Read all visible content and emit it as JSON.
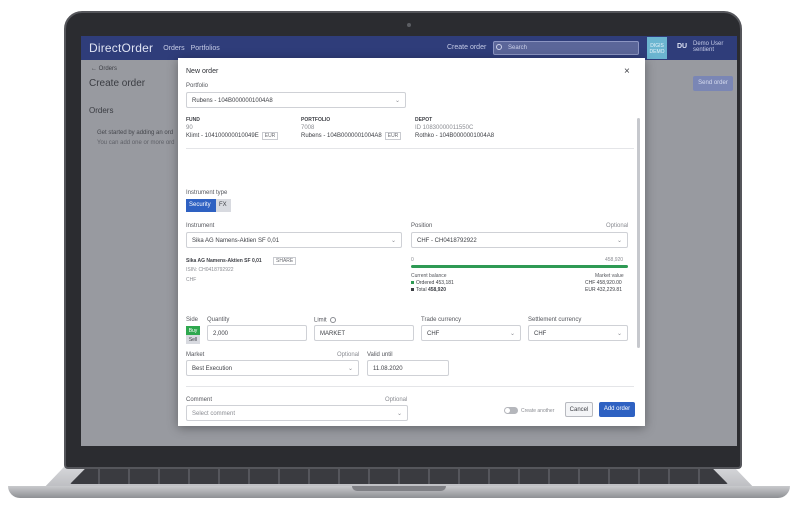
{
  "app": {
    "brand": "DirectOrder",
    "nav": [
      "Orders",
      "Portfolios"
    ],
    "create_order_link": "Create order",
    "search_placeholder": "Search",
    "tile_label": "DIGIS\nDEMO",
    "avatar_initials": "DU",
    "user_name": "Demo User",
    "user_sub": "sentient"
  },
  "page": {
    "back": "← Orders",
    "title": "Create order",
    "orders_heading": "Orders",
    "get_started": "Get started by adding an ord",
    "can_add": "You can add one or more ord",
    "send_button": "Send order"
  },
  "modal": {
    "title": "New order",
    "portfolio_label": "Portfolio",
    "portfolio_value": "Rubens - 104B0000001004A8",
    "fund": {
      "label": "FUND",
      "id": "90",
      "name": "Klimt - 104100000010049E",
      "currency": "EUR"
    },
    "portfolio": {
      "label": "PORTFOLIO",
      "id": "7008",
      "name": "Rubens - 104B0000001004A8",
      "currency": "EUR"
    },
    "depot": {
      "label": "DEPOT",
      "id": "ID 10830000011550C",
      "name": "Rothko - 104B0000001004A8"
    },
    "instrument_type_label": "Instrument type",
    "instrument_type_options": [
      "Security",
      "FX"
    ],
    "instrument_label": "Instrument",
    "instrument_value": "Sika AG Namens-Aktien SF 0,01",
    "position_label": "Position",
    "position_optional": "Optional",
    "position_value": "CHF - CH0418792922",
    "instr_name": "Sika AG Namens-Aktien SF 0,01",
    "instr_tag": "SHARE",
    "instr_isin": "ISIN: CH0418792922",
    "instr_ccy": "CHF",
    "bar_left": "0",
    "bar_right": "458,920",
    "current_balance_label": "Current balance",
    "ordered_label": "Ordered",
    "ordered_value": "453,181",
    "total_label": "Total",
    "total_value": "458,920",
    "market_value_label": "Market value",
    "mv_chf": "CHF 458,920.00",
    "mv_eur": "EUR 432,229.81",
    "side_label": "Side",
    "buy": "Buy",
    "sell": "Sell",
    "quantity_label": "Quantity",
    "quantity_value": "2,000",
    "limit_label": "Limit",
    "limit_value": "MARKET",
    "trade_ccy_label": "Trade currency",
    "trade_ccy_value": "CHF",
    "settle_ccy_label": "Settlement currency",
    "settle_ccy_value": "CHF",
    "market_label": "Market",
    "market_optional": "Optional",
    "market_value": "Best Execution",
    "valid_until_label": "Valid until",
    "valid_until_value": "11.08.2020",
    "comment_label": "Comment",
    "comment_optional": "Optional",
    "comment_placeholder": "Select comment",
    "create_another": "Create another",
    "cancel": "Cancel",
    "add_order": "Add order"
  }
}
